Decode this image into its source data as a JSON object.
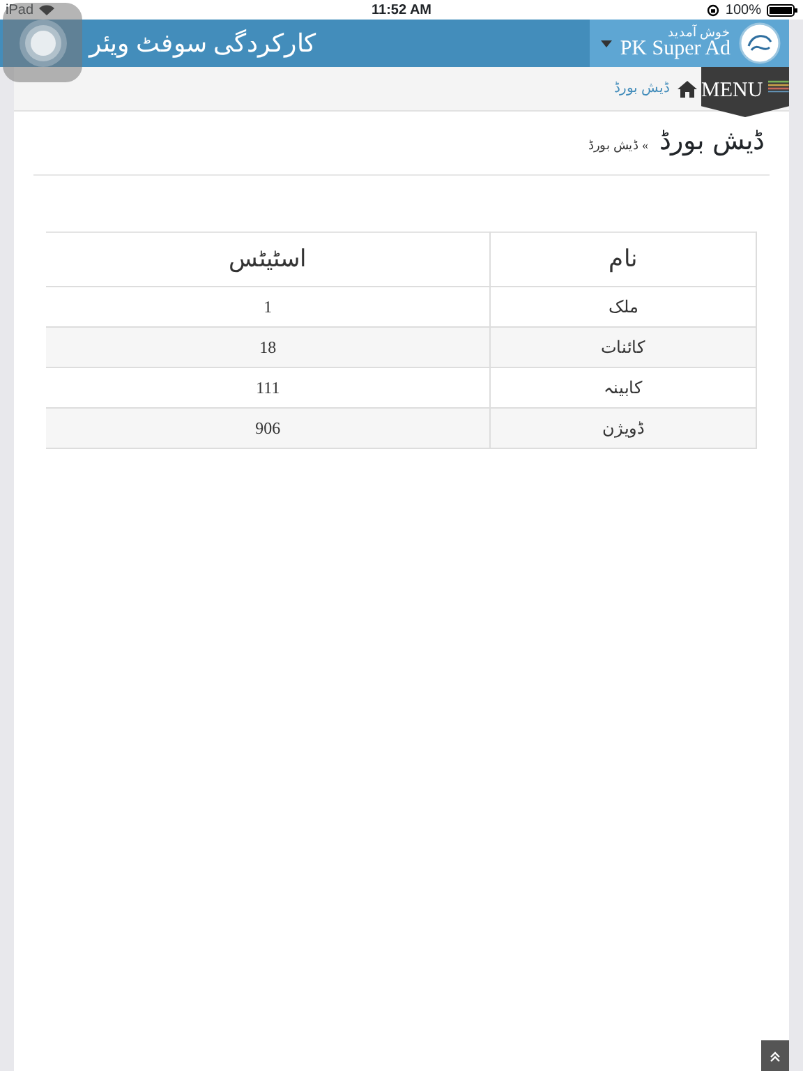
{
  "status_bar": {
    "device": "iPad",
    "time": "11:52 AM",
    "battery": "100%"
  },
  "header": {
    "app_title": "کارکردگی سوفٹ ویئر",
    "welcome": "خوش آمدید",
    "user": "PK Super Ad"
  },
  "breadcrumb": {
    "link": "ڈیش بورڈ"
  },
  "menu_button": "MENU",
  "page_title": {
    "title": "ڈیش بورڈ",
    "trail": "» ڈیش بورڈ"
  },
  "table": {
    "columns": [
      "نام",
      "اسٹیٹس"
    ],
    "rows": [
      {
        "name": "ملک",
        "count": "1"
      },
      {
        "name": "کائنات",
        "count": "18"
      },
      {
        "name": "کابینہ",
        "count": "111"
      },
      {
        "name": "ڈویژن",
        "count": "906"
      }
    ]
  }
}
